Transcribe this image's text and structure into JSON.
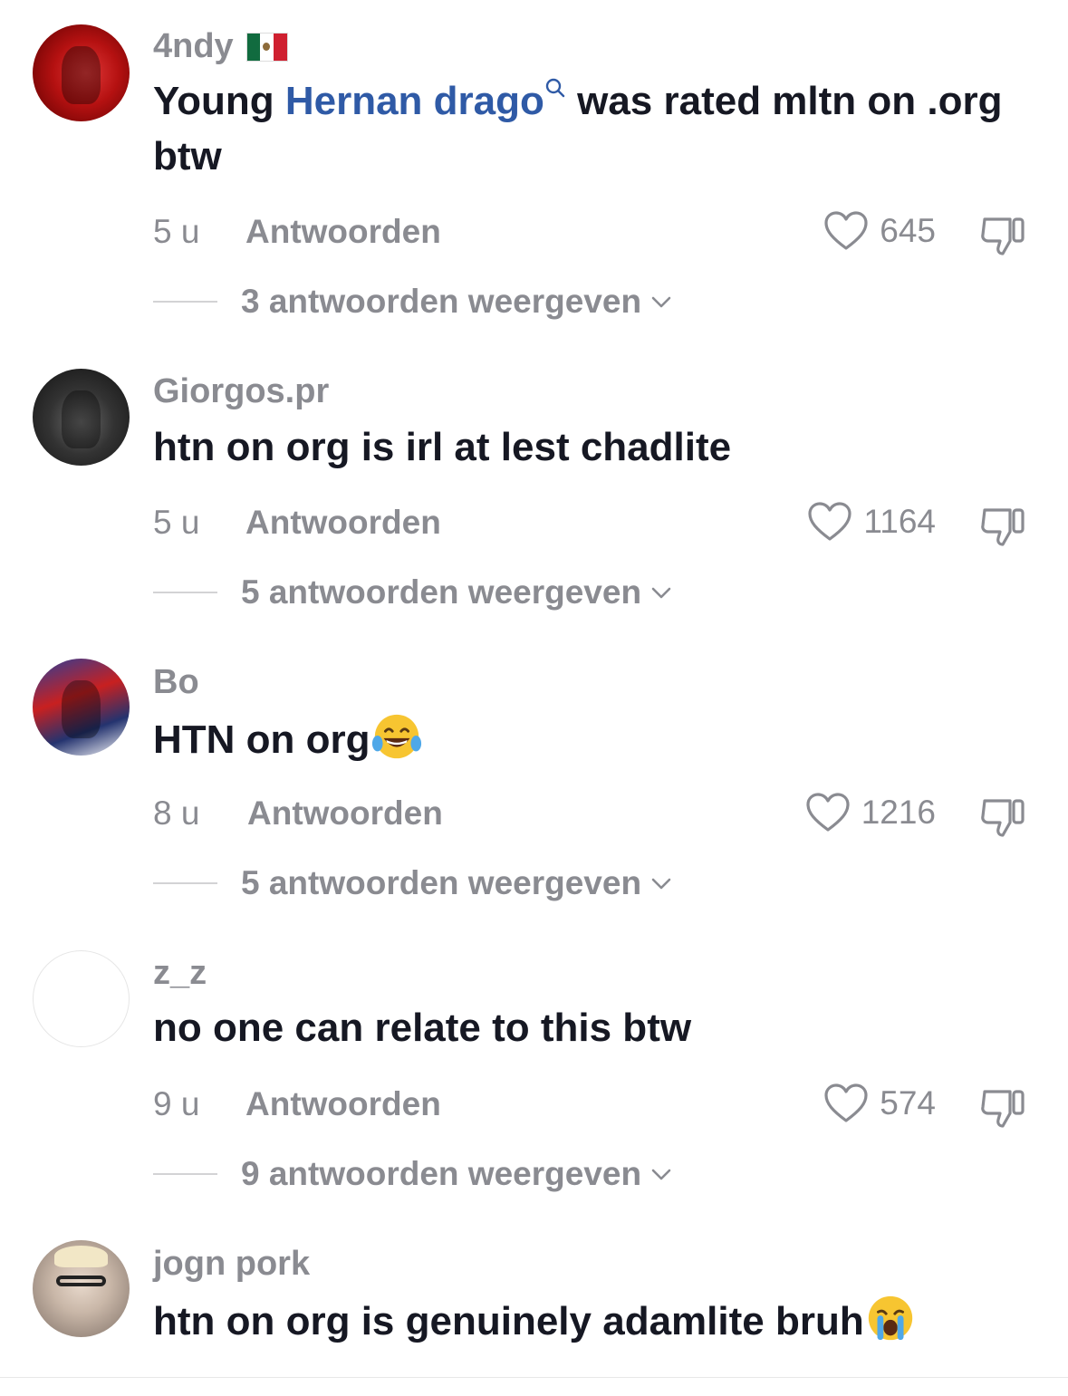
{
  "comments": [
    {
      "username": "4ndy",
      "flag": "mexico-flag",
      "text_before": "Young ",
      "mention": "Hernan drago",
      "text_after": " was rated mltn on .org btw",
      "time": "5 u",
      "reply_label": "Antwoorden",
      "likes": "645",
      "view_replies": "3 antwoorden weergeven"
    },
    {
      "username": "Giorgos.pr",
      "text": "htn on org is irl at lest chadlite",
      "time": "5 u",
      "reply_label": "Antwoorden",
      "likes": "1164",
      "view_replies": "5 antwoorden weergeven"
    },
    {
      "username": "Bo",
      "text": "HTN on org",
      "emoji": "tears-of-joy-emoji",
      "time": "8 u",
      "reply_label": "Antwoorden",
      "likes": "1216",
      "view_replies": "5 antwoorden weergeven"
    },
    {
      "username": "z_z",
      "text": "no one can relate to this btw",
      "time": "9 u",
      "reply_label": "Antwoorden",
      "likes": "574",
      "view_replies": "9 antwoorden weergeven"
    },
    {
      "username": "jogn pork",
      "text": "htn on org is genuinely adamlite bruh",
      "emoji": "loudly-crying-emoji"
    }
  ],
  "colors": {
    "text": "#161823",
    "muted": "#8a8b91",
    "mention": "#2f5aa6"
  }
}
